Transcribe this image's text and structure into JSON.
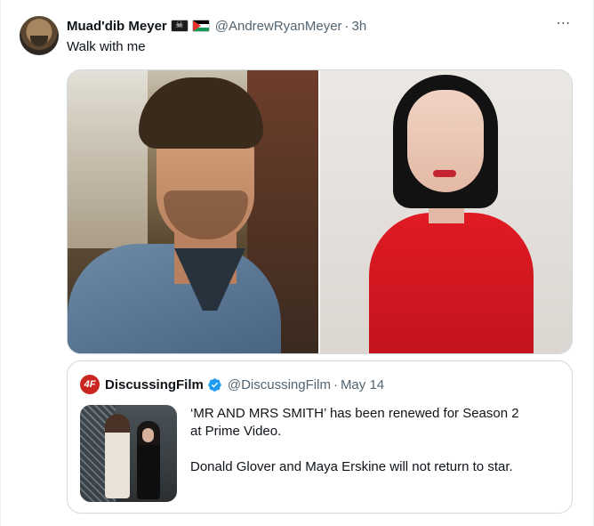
{
  "tweet": {
    "author": {
      "display_name": "Muad'dib Meyer",
      "handle": "@AndrewRyanMeyer",
      "flags": [
        "skull-crossbones-flag",
        "palestine-flag"
      ],
      "separator": "·",
      "time": "3h"
    },
    "text": "Walk with me",
    "more_icon": "⋯",
    "media": [
      {
        "name": "photo-man-denim-jacket"
      },
      {
        "name": "photo-woman-red-dress"
      }
    ]
  },
  "quote": {
    "author": {
      "avatar_text": "4F",
      "display_name": "DiscussingFilm",
      "verified": true,
      "handle": "@DiscussingFilm",
      "separator": "·",
      "time": "May 14"
    },
    "text_lines": [
      "‘MR AND MRS SMITH’ has been renewed for Season 2",
      "at Prime Video.",
      "",
      "Donald Glover and Maya Erskine will not return to star."
    ]
  },
  "colors": {
    "text": "#0f1419",
    "secondary": "#536471",
    "border": "#cfd9de",
    "verified_blue": "#1d9bf0",
    "brand_red": "#c8261e"
  }
}
